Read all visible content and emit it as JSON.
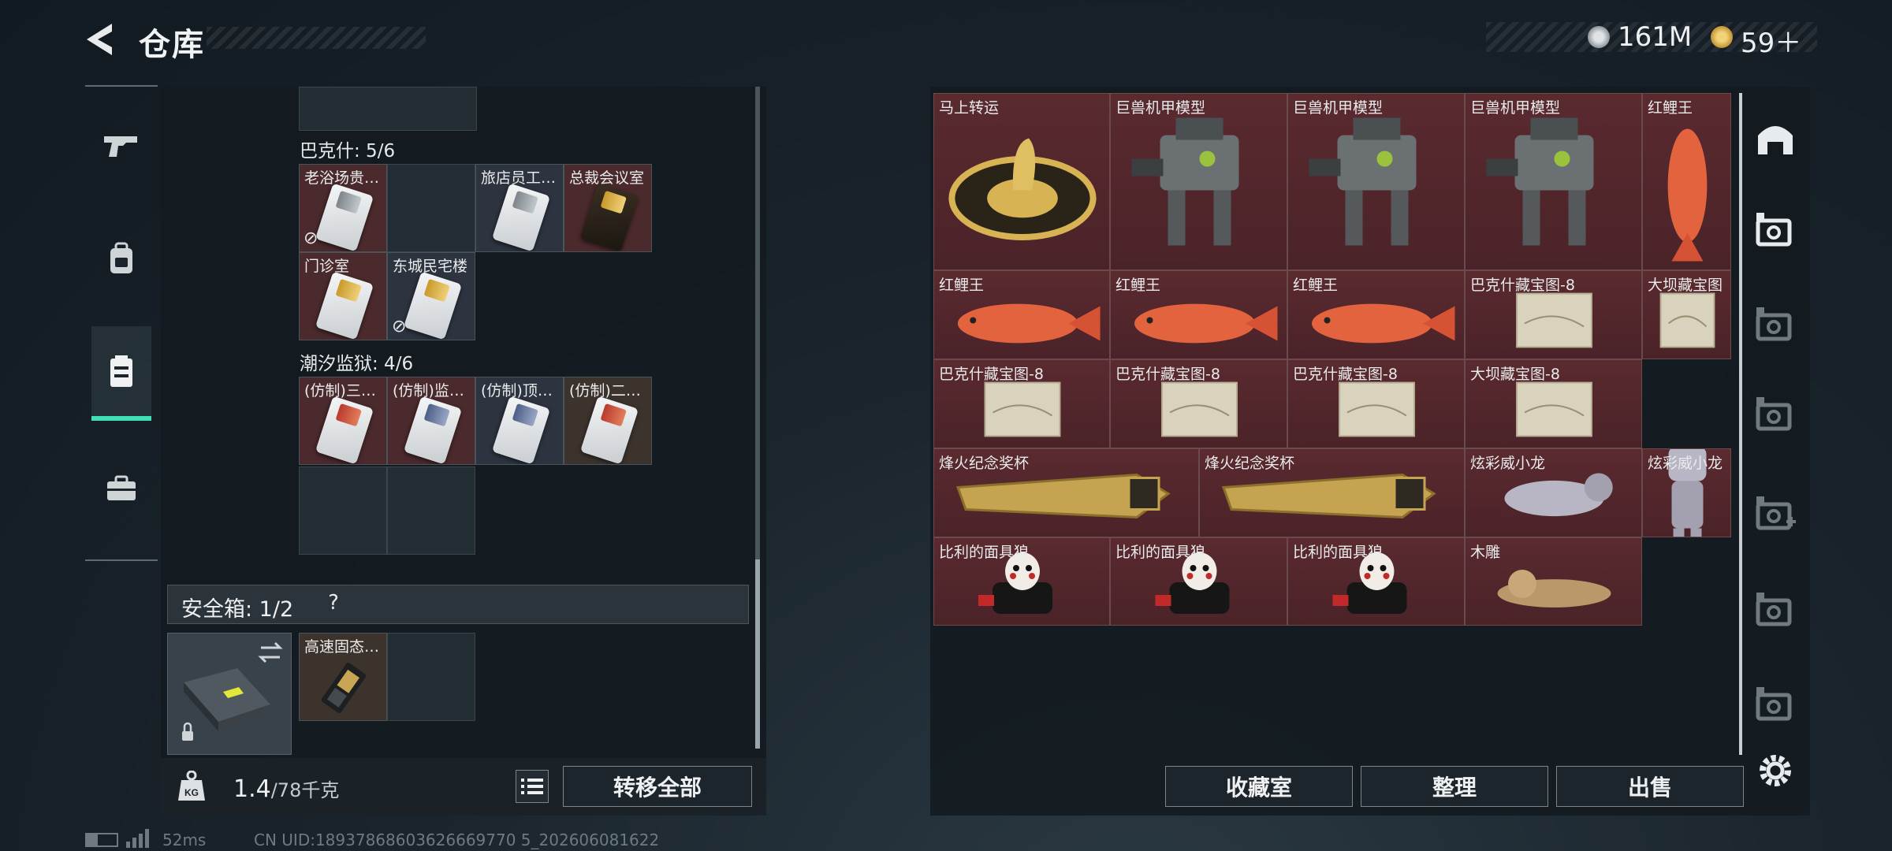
{
  "header": {
    "title": "仓库"
  },
  "currency": [
    {
      "icon": "silver-coin-icon",
      "value": "161M"
    },
    {
      "icon": "gold-coin-icon",
      "value": "59＋"
    }
  ],
  "leftnav": [
    {
      "icon": "gun-icon",
      "active": false
    },
    {
      "icon": "backpack-icon",
      "active": false
    },
    {
      "icon": "chest-rig-icon",
      "active": true
    },
    {
      "icon": "briefcase-icon",
      "active": false
    }
  ],
  "sections": {
    "bakesh": {
      "label": "巴克什: 5/6"
    },
    "chaoxi": {
      "label": "潮汐监狱: 4/6"
    }
  },
  "bakesh_items": [
    {
      "label": "老浴场贵宾室",
      "bg": "red",
      "card": "stripe-gray",
      "no_icon": true
    },
    {
      "label": "",
      "bg": "empty",
      "card": "",
      "no_icon": false
    },
    {
      "label": "旅店员工休息室",
      "bg": "navy",
      "card": "stripe-gray",
      "no_icon": false
    },
    {
      "label": "总裁会议室",
      "bg": "red",
      "card": "gold",
      "no_icon": false
    },
    {
      "label": "门诊室",
      "bg": "red",
      "card": "stripe-gold",
      "no_icon": false
    },
    {
      "label": "东城民宅楼",
      "bg": "navy",
      "card": "stripe-gold",
      "no_icon": true
    }
  ],
  "chaoxi_items": [
    {
      "label": "(仿制)三号牢房",
      "bg": "red",
      "card": "stripe-red",
      "no_icon": false
    },
    {
      "label": "(仿制)监控室",
      "bg": "red",
      "card": "stripe-blue",
      "no_icon": false
    },
    {
      "label": "(仿制)顶层牢房",
      "bg": "navy",
      "card": "stripe-blue",
      "no_icon": false
    },
    {
      "label": "(仿制)二号牢房",
      "bg": "brown",
      "card": "stripe-red",
      "no_icon": false
    }
  ],
  "safebox": {
    "label": "安全箱: 1/2",
    "help": "?",
    "item_label": "高速固态硬盘"
  },
  "weight": {
    "current": "1.4",
    "max": "/78千克"
  },
  "left_actions": {
    "transfer_all": "转移全部"
  },
  "stash": [
    {
      "label": "马上转运",
      "art": "medallion"
    },
    {
      "label": "巨兽机甲模型",
      "art": "mech"
    },
    {
      "label": "巨兽机甲模型",
      "art": "mech"
    },
    {
      "label": "巨兽机甲模型",
      "art": "mech"
    },
    {
      "label": "红鲤王",
      "art": "fish-vertical"
    },
    {
      "label": "红鲤王",
      "art": "fish"
    },
    {
      "label": "红鲤王",
      "art": "fish"
    },
    {
      "label": "红鲤王",
      "art": "fish"
    },
    {
      "label": "巴克什藏宝图-8",
      "art": "map"
    },
    {
      "label": "大坝藏宝图",
      "art": "map"
    },
    {
      "label": "巴克什藏宝图-8",
      "art": "map"
    },
    {
      "label": "巴克什藏宝图-8",
      "art": "map"
    },
    {
      "label": "巴克什藏宝图-8",
      "art": "map"
    },
    {
      "label": "大坝藏宝图-8",
      "art": "map"
    },
    {
      "label": "烽火纪念奖杯",
      "art": "trophy"
    },
    {
      "label": "烽火纪念奖杯",
      "art": "trophy"
    },
    {
      "label": "炫彩威小龙",
      "art": "toy"
    },
    {
      "label": "炫彩威小龙",
      "art": "toy-vertical"
    },
    {
      "label": "比利的面具狼",
      "art": "puppet"
    },
    {
      "label": "比利的面具狼",
      "art": "puppet"
    },
    {
      "label": "比利的面具狼",
      "art": "puppet"
    },
    {
      "label": "木雕",
      "art": "carving"
    }
  ],
  "right_actions": {
    "collection": "收藏室",
    "organize": "整理",
    "sell": "出售"
  },
  "right_nav": [
    {
      "icon": "home-icon"
    },
    {
      "icon": "stash-iv-selected-icon"
    },
    {
      "icon": "stash-iv-icon"
    },
    {
      "icon": "stash-v-icon"
    },
    {
      "icon": "stash-iv-add-icon"
    },
    {
      "icon": "stash-container-icon"
    },
    {
      "icon": "stash-gti-icon"
    },
    {
      "icon": "settings-gear-icon"
    }
  ],
  "footer": {
    "ping": "52ms",
    "uid": "CN UID:18937868603626669770 5_202606081622"
  }
}
